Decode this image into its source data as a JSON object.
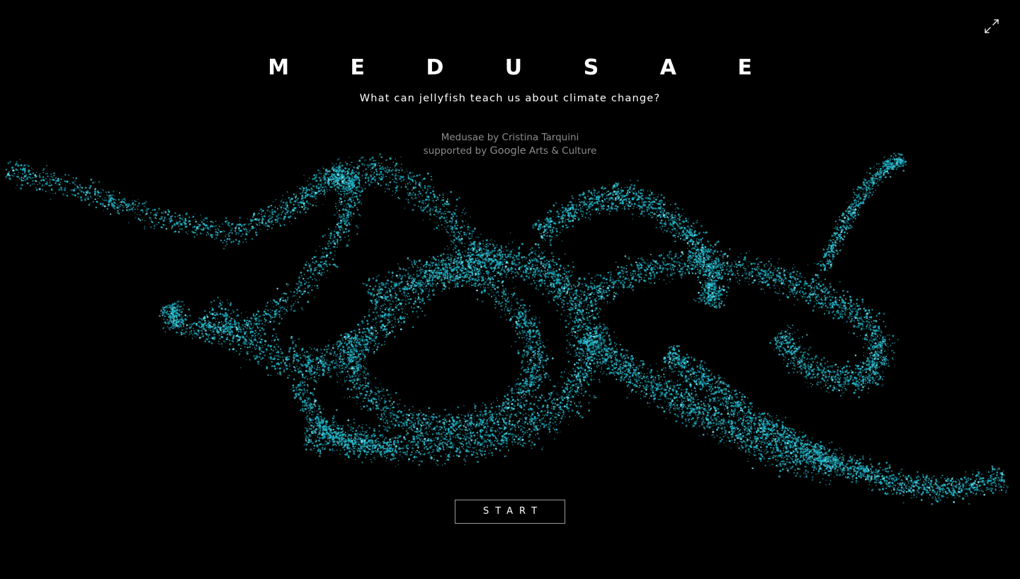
{
  "title": "M E D U S A E",
  "subtitle": "What can jellyfish teach us about climate change?",
  "credits": {
    "line1": "Medusae by Cristina Tarquini",
    "line2_prefix": "supported by",
    "line2_brand": "Google",
    "line2_suffix": "Arts & Culture"
  },
  "start_label": "START",
  "icons": {
    "fullscreen": "expand-arrows-icon"
  },
  "colors": {
    "background": "#000000",
    "particle": "#1fb5c9",
    "particle_bright": "#7fe8f2",
    "text": "#ffffff",
    "muted": "#8c8c8c"
  }
}
